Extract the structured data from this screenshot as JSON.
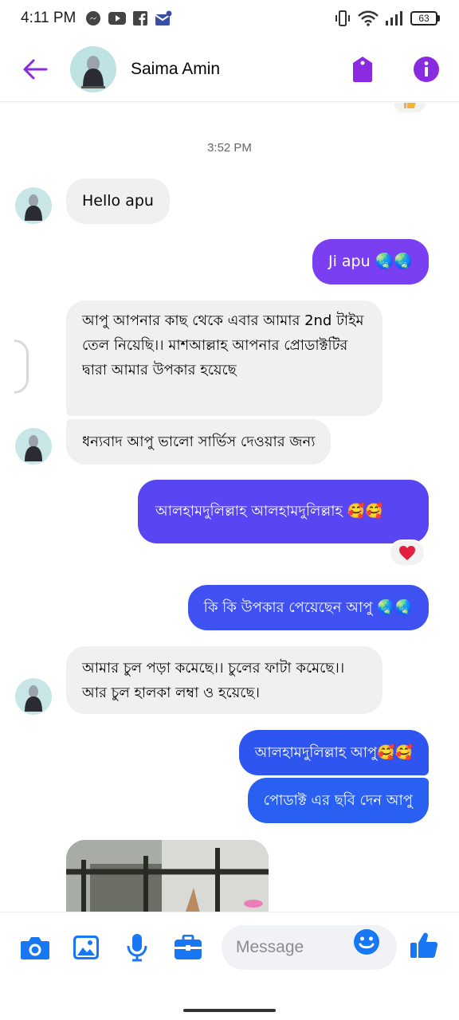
{
  "status_bar": {
    "time": "4:11 PM",
    "battery": "63",
    "icons": [
      "messenger-icon",
      "youtube-icon",
      "facebook-icon",
      "mail-icon",
      "vibrate-icon",
      "wifi-icon",
      "signal-icon",
      "battery-icon"
    ]
  },
  "header": {
    "contact_name": "Saima Amin",
    "icons": [
      "back-arrow-icon",
      "tag-icon",
      "info-icon"
    ]
  },
  "colors": {
    "accent": "#8a2be2",
    "outgoing_purple": "#7b3ff2",
    "outgoing_blue": "#2f55f1",
    "incoming_bg": "#f0f0f0",
    "heart": "#e41e3f"
  },
  "conversation": {
    "timestamp": "3:52 PM",
    "messages": [
      {
        "dir": "in",
        "text": "Hello apu"
      },
      {
        "dir": "out",
        "text": "Ji apu 🌏🌏"
      },
      {
        "dir": "in",
        "text": "আপু আপনার কাছ থেকে এবার আমার 2nd টাইম তেল নিয়েছি।। মাশআল্লাহ আপনার প্রোডাক্টটির দ্বারা আমার উপকার হয়েছে"
      },
      {
        "dir": "in",
        "text": "ধন্যবাদ আপু ভালো সার্ভিস দেওয়ার জন্য"
      },
      {
        "dir": "out",
        "text": "আলহামদুলিল্লাহ আলহামদুলিল্লাহ 🥰🥰",
        "reaction": "❤️"
      },
      {
        "dir": "out",
        "text": "কি কি উপকার পেয়েছেন আপু 🌏🌏"
      },
      {
        "dir": "in",
        "text": "আমার চুল পড়া কমেছে।। চুলের ফাটা কমেছে।। আর চুল হালকা লম্বা ও হয়েছে।"
      },
      {
        "dir": "out",
        "text": "আলহামদুলিল্লাহ আপু🥰🥰"
      },
      {
        "dir": "out",
        "text": "পোডাক্ট এর ছবি দেন আপু"
      },
      {
        "dir": "in",
        "type": "photo"
      }
    ]
  },
  "composer": {
    "placeholder": "Message",
    "icons": [
      "camera-icon",
      "image-icon",
      "microphone-icon",
      "briefcase-icon",
      "emoji-icon",
      "thumbs-up-icon"
    ]
  }
}
